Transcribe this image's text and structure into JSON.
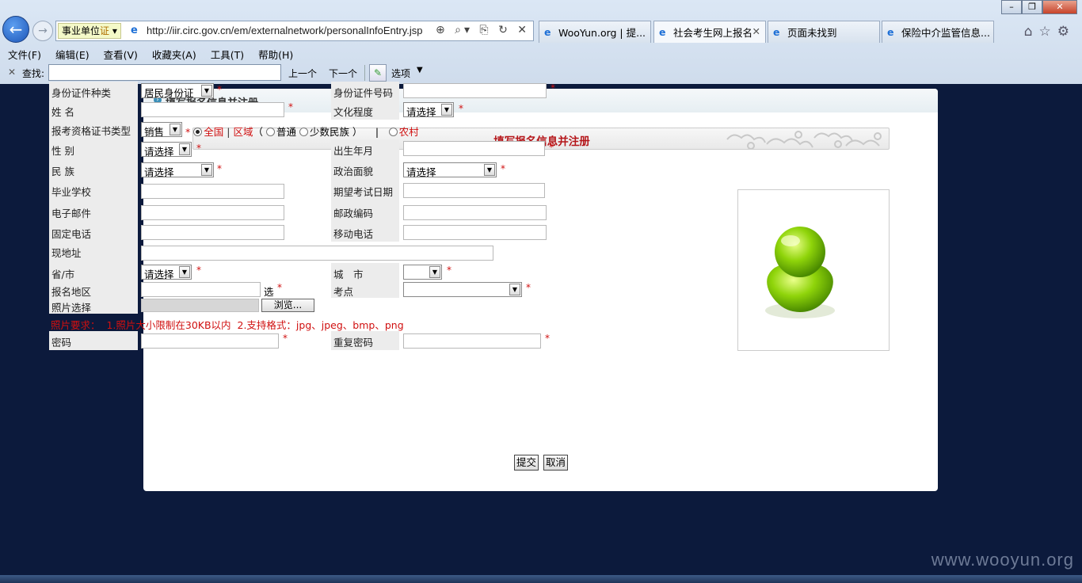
{
  "browser": {
    "cert_label": "事业单位",
    "cert_badge": "证",
    "url": "http://iir.circ.gov.cn/em/externalnetwork/personalInfoEntry.jsp",
    "tabs": [
      {
        "label": "WooYun.org | 提..."
      },
      {
        "label": "社会考生网上报名",
        "active": true
      },
      {
        "label": "页面未找到"
      },
      {
        "label": "保险中介监管信息..."
      }
    ],
    "menu": [
      "文件(F)",
      "编辑(E)",
      "查看(V)",
      "收藏夹(A)",
      "工具(T)",
      "帮助(H)"
    ],
    "find": {
      "label": "查找:",
      "value": "",
      "prev": "上一个",
      "next": "下一个",
      "options": "选项"
    }
  },
  "page": {
    "header_title": "填写报名信息并注册",
    "form_title": "填写报名信息并注册",
    "fields": {
      "id_type": {
        "label": "身份证件种类",
        "value": "居民身份证"
      },
      "id_number": {
        "label": "身份证件号码",
        "value": ""
      },
      "name": {
        "label": "姓 名",
        "value": ""
      },
      "education": {
        "label": "文化程度",
        "value": "请选择"
      },
      "cert_type": {
        "label": "报考资格证书类型",
        "value": "销售"
      },
      "scope_national": "全国",
      "scope_region": "区域",
      "region_normal": "普通",
      "region_minority": "少数民族",
      "rural": "农村",
      "gender": {
        "label": "性 别",
        "value": "请选择"
      },
      "birth": {
        "label": "出生年月",
        "value": ""
      },
      "ethnicity": {
        "label": "民 族",
        "value": "请选择"
      },
      "political": {
        "label": "政治面貌",
        "value": "请选择"
      },
      "school": {
        "label": "毕业学校",
        "value": ""
      },
      "exam_date": {
        "label": "期望考试日期",
        "value": ""
      },
      "email": {
        "label": "电子邮件",
        "value": ""
      },
      "postcode": {
        "label": "邮政编码",
        "value": ""
      },
      "phone": {
        "label": "固定电话",
        "value": ""
      },
      "mobile": {
        "label": "移动电话",
        "value": ""
      },
      "address": {
        "label": "现地址",
        "value": ""
      },
      "province": {
        "label": "省/市",
        "value": "请选择"
      },
      "city": {
        "label": "城　市",
        "value": ""
      },
      "area": {
        "label": "报名地区",
        "value": "",
        "suffix": "选"
      },
      "exam_site": {
        "label": "考点",
        "value": ""
      },
      "photo": {
        "label": "照片选择",
        "browse": "浏览..."
      },
      "photo_req": "照片要求：  1.照片大小限制在30KB以内  2.支持格式：jpg、jpeg、bmp、png",
      "password": {
        "label": "密码",
        "value": ""
      },
      "password2": {
        "label": "重复密码",
        "value": ""
      }
    },
    "required_mark": "*",
    "submit": "提交",
    "cancel": "取消"
  },
  "watermark": "www.wooyun.org",
  "colors": {
    "accent_red": "#d01010",
    "page_bg": "#0c1a3c",
    "title_red": "#b5161a"
  }
}
